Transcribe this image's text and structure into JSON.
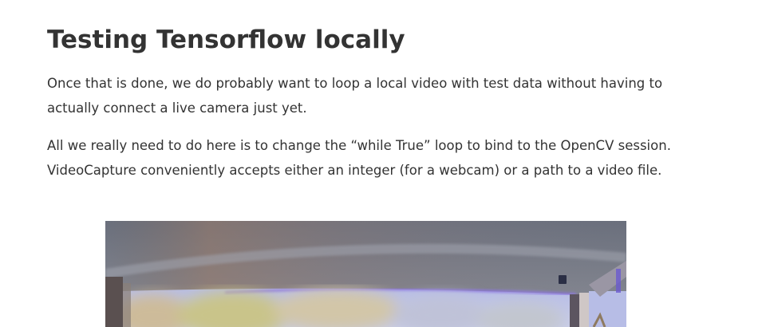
{
  "article": {
    "title": "Testing Tensorflow locally",
    "paragraphs": [
      "Once that is done, we do probably want to loop a local video with test data without having to actually connect a live camera just yet.",
      "All we really need to do here is to change the “while True” loop to bind to the OpenCV session. VideoCapture conveniently accepts either an integer (for a webcam) or a path to a video file."
    ]
  }
}
